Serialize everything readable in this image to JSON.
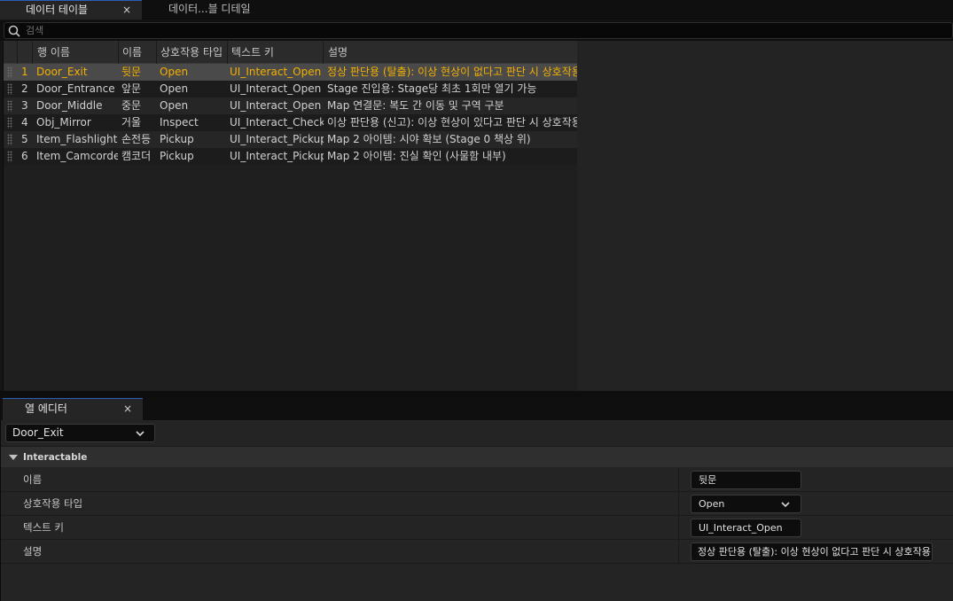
{
  "tabs": [
    {
      "label": "데이터 테이블",
      "close": "×"
    },
    {
      "label": "데이터...블 디테일"
    }
  ],
  "search": {
    "placeholder": "검색"
  },
  "table": {
    "columns": [
      "행 이름",
      "이름",
      "상호작용 타입",
      "텍스트 키",
      "설명"
    ],
    "rows": [
      {
        "num": "1",
        "row_name": "Door_Exit",
        "name": "뒷문",
        "type": "Open",
        "text_key": "UI_Interact_Open",
        "desc": "정상 판단용 (탈출): 이상 현상이 없다고 판단 시 상호작용"
      },
      {
        "num": "2",
        "row_name": "Door_Entrance",
        "name": "앞문",
        "type": "Open",
        "text_key": "UI_Interact_Open",
        "desc": "Stage 진입용: Stage당 최초 1회만 열기 가능"
      },
      {
        "num": "3",
        "row_name": "Door_Middle",
        "name": "중문",
        "type": "Open",
        "text_key": "UI_Interact_Open",
        "desc": "Map 연결문: 복도 간 이동 및 구역 구분"
      },
      {
        "num": "4",
        "row_name": "Obj_Mirror",
        "name": "거울",
        "type": "Inspect",
        "text_key": "UI_Interact_Check",
        "desc": "이상 판단용 (신고): 이상 현상이 있다고 판단 시 상호작용"
      },
      {
        "num": "5",
        "row_name": "Item_Flashlight",
        "name": "손전등",
        "type": "Pickup",
        "text_key": "UI_Interact_Pickup",
        "desc": "Map 2 아이템: 시야 확보 (Stage 0 책상 위)"
      },
      {
        "num": "6",
        "row_name": "Item_Camcorde",
        "name": "캠코더",
        "type": "Pickup",
        "text_key": "UI_Interact_Pickup",
        "desc": "Map 2 아이템: 진실 확인 (사물함 내부)"
      }
    ]
  },
  "editor": {
    "tab_label": "열 에디터",
    "tab_close": "×",
    "selected_row": "Door_Exit",
    "section": "Interactable",
    "props": [
      {
        "label": "이름",
        "value": "뒷문"
      },
      {
        "label": "상호작용 타입",
        "value": "Open"
      },
      {
        "label": "텍스트 키",
        "value": "UI_Interact_Open"
      },
      {
        "label": "설명",
        "value": "정상 판단용 (탈출): 이상 현상이 없다고 판단 시 상호작용"
      }
    ]
  }
}
